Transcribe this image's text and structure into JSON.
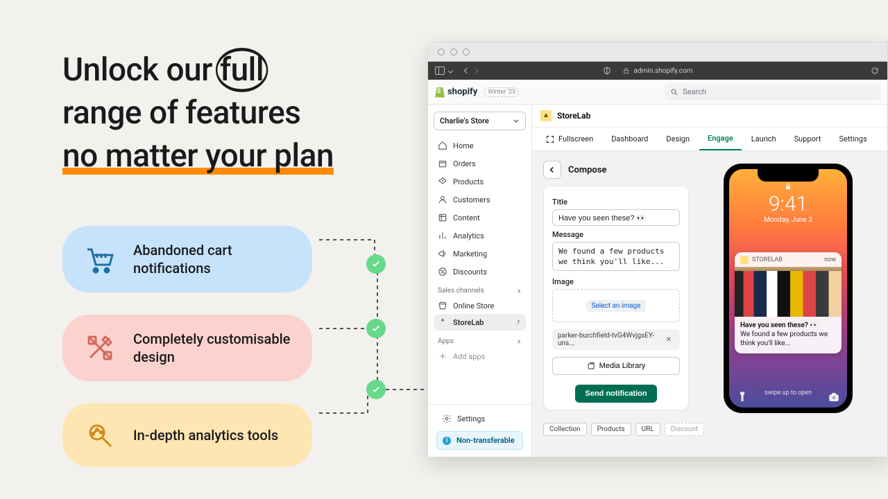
{
  "marketing": {
    "headline_part1": "Unlock our ",
    "headline_circled": "full",
    "headline_part2": "range of features",
    "headline_underlined": "no matter your plan",
    "features": [
      {
        "label": "Abandoned cart notifications"
      },
      {
        "label": "Completely customisable design"
      },
      {
        "label": "In-depth analytics tools"
      }
    ]
  },
  "browser": {
    "url_host": "admin.shopify.com"
  },
  "shopify": {
    "brand": "shopify",
    "season_tag": "Winter '23",
    "search_placeholder": "Search",
    "store_name": "Charlie's Store",
    "nav": {
      "home": "Home",
      "orders": "Orders",
      "products": "Products",
      "customers": "Customers",
      "content": "Content",
      "analytics": "Analytics",
      "marketing": "Marketing",
      "discounts": "Discounts"
    },
    "sales_channels_label": "Sales channels",
    "online_store": "Online Store",
    "storelab": "StoreLab",
    "apps_label": "Apps",
    "add_apps": "Add apps",
    "settings_label": "Settings",
    "alert_label": "Non-transferable"
  },
  "storelab": {
    "app_name": "StoreLab",
    "tabs": {
      "fullscreen": "Fullscreen",
      "dashboard": "Dashboard",
      "design": "Design",
      "engage": "Engage",
      "launch": "Launch",
      "support": "Support",
      "settings": "Settings"
    },
    "compose": {
      "heading": "Compose",
      "title_label": "Title",
      "title_value": "Have you seen these? 👀",
      "message_label": "Message",
      "message_value": "We found a few products we think you'll like...",
      "image_label": "Image",
      "select_image": "Select an image",
      "file_name": "parker-burchfield-tvG4WvjgsEY-uns...",
      "media_library": "Media Library",
      "send": "Send notification"
    },
    "targets": {
      "collection": "Collection",
      "products": "Products",
      "url": "URL",
      "discount": "Discount"
    }
  },
  "phone": {
    "time": "9:41",
    "date": "Monday, June 3",
    "notif": {
      "app": "STORELAB",
      "when": "now",
      "title": "Have you seen these? 👀",
      "body": "We found a few products we think you'll like..."
    },
    "swipe": "swipe up to open"
  }
}
